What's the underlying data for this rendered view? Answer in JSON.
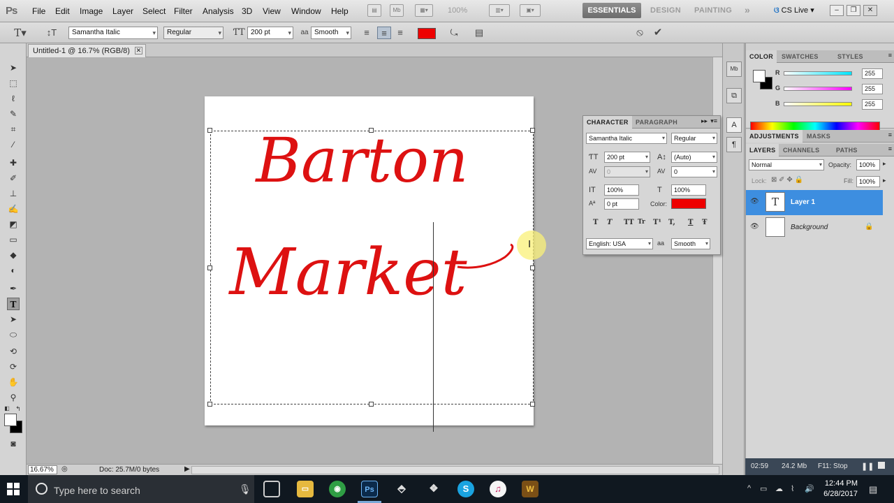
{
  "app": {
    "logo": "Ps"
  },
  "menu": [
    "File",
    "Edit",
    "Image",
    "Layer",
    "Select",
    "Filter",
    "Analysis",
    "3D",
    "View",
    "Window",
    "Help"
  ],
  "menubar": {
    "zoom": "100%",
    "workspaces": [
      "ESSENTIALS",
      "DESIGN",
      "PAINTING"
    ],
    "more": "»",
    "cs_live": "CS Live",
    "icon_mb": "Mb"
  },
  "options": {
    "font_family": "Samantha Italic",
    "font_style": "Regular",
    "font_size": "200 pt",
    "antialias_label": "aa",
    "antialias": "Smooth",
    "text_color": "#ee0000"
  },
  "document": {
    "tab_title": "Untitled-1 @ 16.7% (RGB/8)",
    "line1": "Barton",
    "line2": "Market"
  },
  "status": {
    "zoom": "16.67%",
    "doc": "Doc: 25.7M/0 bytes"
  },
  "character": {
    "tabs": [
      "CHARACTER",
      "PARAGRAPH"
    ],
    "font_family": "Samantha Italic",
    "font_style": "Regular",
    "size": "200 pt",
    "leading": "(Auto)",
    "kerning": "0",
    "tracking": "0",
    "vscale": "100%",
    "hscale": "100%",
    "baseline": "0 pt",
    "color_label": "Color:",
    "style_buttons": [
      "T",
      "T",
      "TT",
      "Tr",
      "T¹",
      "T,",
      "T",
      "Ŧ"
    ],
    "language": "English: USA",
    "antialias": "Smooth"
  },
  "color_panel": {
    "tabs": [
      "COLOR",
      "SWATCHES",
      "STYLES"
    ],
    "channels": [
      {
        "label": "R",
        "value": "255",
        "gradient": "#00e5ff"
      },
      {
        "label": "G",
        "value": "255",
        "gradient": "#ff00ff"
      },
      {
        "label": "B",
        "value": "255",
        "gradient": "#ffff00"
      }
    ]
  },
  "adjustments": {
    "tabs": [
      "ADJUSTMENTS",
      "MASKS"
    ]
  },
  "layers": {
    "tabs": [
      "LAYERS",
      "CHANNELS",
      "PATHS"
    ],
    "blend": "Normal",
    "opacity_label": "Opacity:",
    "opacity": "100%",
    "lock_label": "Lock:",
    "fill_label": "Fill:",
    "fill": "100%",
    "items": [
      {
        "name": "Layer 1",
        "thumb": "T",
        "selected": true
      },
      {
        "name": "Background",
        "thumb": "",
        "selected": false
      }
    ]
  },
  "bottom_status": {
    "time": "02:59",
    "mem": "24.2 Mb",
    "key": "F11: Stop"
  },
  "taskbar": {
    "search_placeholder": "Type here to search",
    "clock_time": "12:44 PM",
    "clock_date": "6/28/2017",
    "ps_label": "Ps"
  }
}
